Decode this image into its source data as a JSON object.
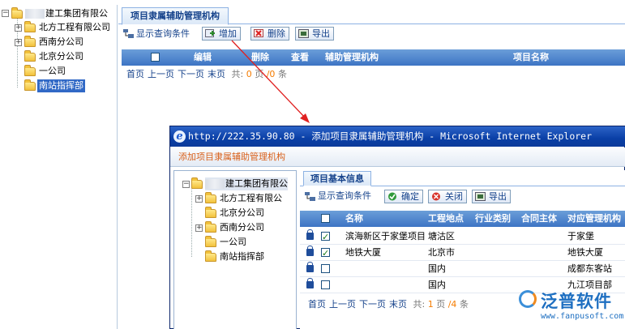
{
  "main_tree": {
    "root_label": "建工集团有限公",
    "items": [
      {
        "label": "北方工程有限公司",
        "expandable": true
      },
      {
        "label": "西南分公司",
        "expandable": true
      },
      {
        "label": "北京分公司",
        "expandable": false
      },
      {
        "label": "一公司",
        "expandable": false
      },
      {
        "label": "南站指挥部",
        "expandable": false,
        "selected": true
      }
    ]
  },
  "main": {
    "tab_label": "项目隶属辅助管理机构",
    "toolbar": {
      "show_query": "显示查询条件",
      "add": "增加",
      "delete": "删除",
      "export": "导出"
    },
    "grid_columns": [
      "编辑",
      "删除",
      "查看",
      "辅助管理机构",
      "项目名称"
    ],
    "pager": {
      "first": "首页",
      "prev": "上一页",
      "next": "下一页",
      "last": "末页",
      "total_prefix": "共:",
      "current_page": "0",
      "page_unit": "页",
      "total_count": "/0",
      "count_unit": "条"
    }
  },
  "popup": {
    "window_title": "http://222.35.90.80 - 添加项目隶属辅助管理机构 - Microsoft Internet Explorer",
    "header": "添加项目隶属辅助管理机构",
    "tree": {
      "root_label": "建工集团有限公",
      "items": [
        {
          "label": "北方工程有限公",
          "expandable": true
        },
        {
          "label": "北京分公司",
          "expandable": false
        },
        {
          "label": "西南分公司",
          "expandable": true
        },
        {
          "label": "一公司",
          "expandable": false
        },
        {
          "label": "南站指挥部",
          "expandable": false
        }
      ]
    },
    "tab_label": "项目基本信息",
    "toolbar": {
      "show_query": "显示查询条件",
      "confirm": "确定",
      "close": "关闭",
      "export": "导出"
    },
    "grid_columns": [
      "名称",
      "工程地点",
      "行业类别",
      "合同主体",
      "对应管理机构"
    ],
    "rows": [
      {
        "name": "滨海新区于家堡项目",
        "location": "塘沽区",
        "industry": "",
        "contract": "",
        "org": "于家堡",
        "checked": true
      },
      {
        "name": "地铁大厦",
        "location": "北京市",
        "industry": "",
        "contract": "",
        "org": "地铁大厦",
        "checked": true
      },
      {
        "name": "",
        "location": "国内",
        "industry": "",
        "contract": "",
        "org": "成都东客站",
        "checked": false
      },
      {
        "name": "",
        "location": "国内",
        "industry": "",
        "contract": "",
        "org": "九江项目部",
        "checked": false
      }
    ],
    "pager": {
      "first": "首页",
      "prev": "上一页",
      "next": "下一页",
      "last": "末页",
      "total_prefix": "共:",
      "current_page": "1",
      "page_unit": "页",
      "total_count": "/4",
      "count_unit": "条"
    }
  },
  "watermark": {
    "brand": "泛普软件",
    "url": "www.fanpusoft.com"
  },
  "colors": {
    "grid_header": "#3d74c4",
    "tab_text": "#15428b",
    "popup_header_text": "#d8601a",
    "arrow": "#e02020",
    "pager_number": "#f57c00"
  }
}
